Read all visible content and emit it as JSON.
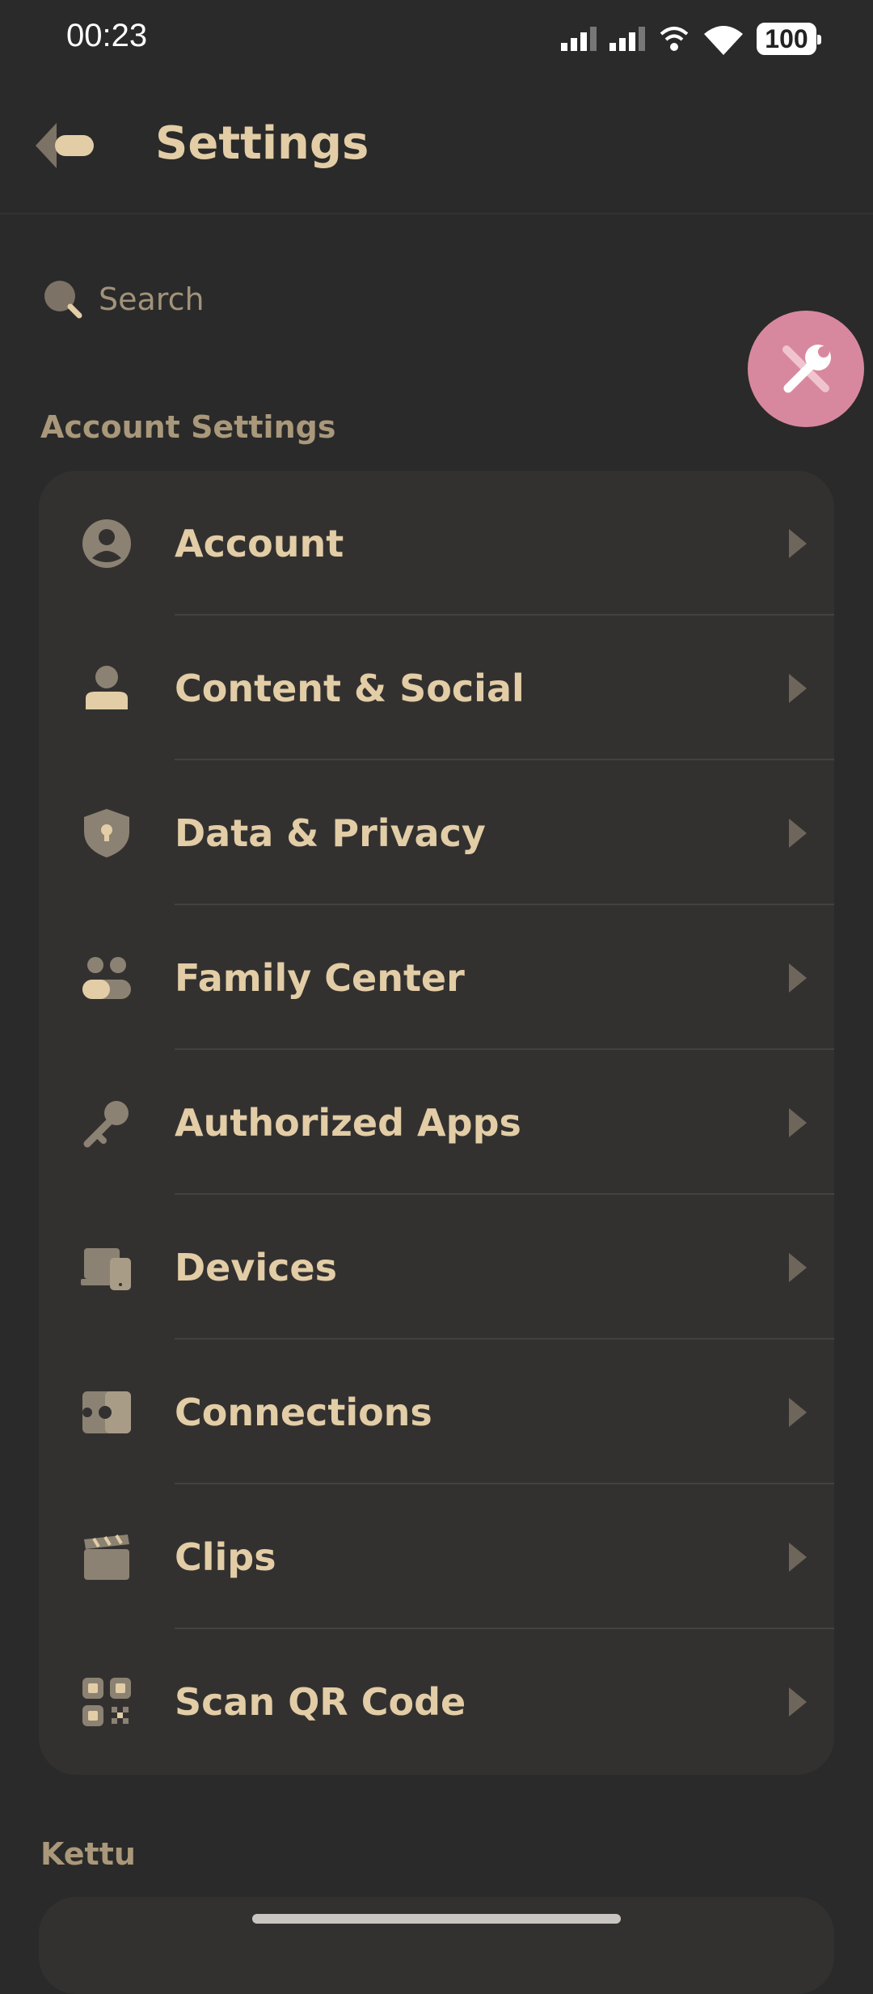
{
  "status_bar": {
    "time": "00:23",
    "battery": "100"
  },
  "header": {
    "title": "Settings"
  },
  "search": {
    "placeholder": "Search"
  },
  "sections": {
    "account_settings": "Account Settings",
    "kettu": "Kettu"
  },
  "menu": [
    {
      "label": "Account",
      "icon": "account-circle-icon"
    },
    {
      "label": "Content & Social",
      "icon": "person-icon"
    },
    {
      "label": "Data & Privacy",
      "icon": "shield-lock-icon"
    },
    {
      "label": "Family Center",
      "icon": "family-icon"
    },
    {
      "label": "Authorized Apps",
      "icon": "key-icon"
    },
    {
      "label": "Devices",
      "icon": "devices-icon"
    },
    {
      "label": "Connections",
      "icon": "puzzle-icon"
    },
    {
      "label": "Clips",
      "icon": "clapperboard-icon"
    },
    {
      "label": "Scan QR Code",
      "icon": "qr-code-icon"
    }
  ],
  "colors": {
    "background": "#2a2a2a",
    "card": "#333130",
    "text": "#e2cda6",
    "icon": "#8c8273",
    "fab": "#d8889e"
  }
}
